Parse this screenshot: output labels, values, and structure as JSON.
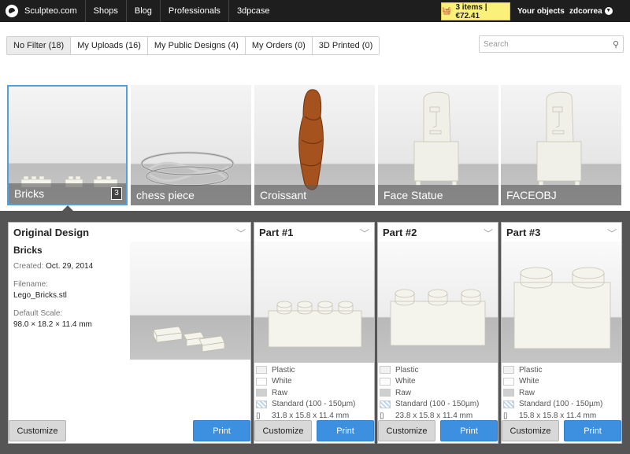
{
  "topbar": {
    "logo_text": "Sculpteo.com",
    "nav": [
      "Shops",
      "Blog",
      "Professionals",
      "3dpcase"
    ],
    "cart_label": "3 items | €72.41",
    "your_objects": "Your objects",
    "user": "zdcorrea"
  },
  "filters": [
    {
      "label": "No Filter",
      "count": "(18)",
      "active": true
    },
    {
      "label": "My Uploads",
      "count": "(16)"
    },
    {
      "label": "My Public Designs",
      "count": "(4)"
    },
    {
      "label": "My Orders",
      "count": "(0)"
    },
    {
      "label": "3D Printed",
      "count": "(0)"
    }
  ],
  "search": {
    "placeholder": "Search"
  },
  "thumbnails": [
    {
      "title": "Bricks",
      "badge": "3",
      "selected": true
    },
    {
      "title": "chess piece"
    },
    {
      "title": "Croissant"
    },
    {
      "title": "Face Statue"
    },
    {
      "title": "FACEOBJ"
    }
  ],
  "original": {
    "header": "Original Design",
    "name": "Bricks",
    "created_label": "Created:",
    "created_value": "Oct. 29, 2014",
    "filename_label": "Filename:",
    "filename_value": "Lego_Bricks.stl",
    "scale_label": "Default Scale:",
    "scale_value": "98.0 × 18.2 × 11.4 mm",
    "customize_label": "Customize",
    "print_label": "Print"
  },
  "parts": [
    {
      "header": "Part #1",
      "material": "Plastic",
      "color": "White",
      "finish": "Raw",
      "quality": "Standard (100 - 150µm)",
      "dimensions": "31.8 x 15.8 x 11.4 mm",
      "customize_label": "Customize",
      "print_label": "Print"
    },
    {
      "header": "Part #2",
      "material": "Plastic",
      "color": "White",
      "finish": "Raw",
      "quality": "Standard (100 - 150µm)",
      "dimensions": "23.8 x 15.8 x 11.4 mm",
      "customize_label": "Customize",
      "print_label": "Print"
    },
    {
      "header": "Part #3",
      "material": "Plastic",
      "color": "White",
      "finish": "Raw",
      "quality": "Standard (100 - 150µm)",
      "dimensions": "15.8 x 15.8 x 11.4 mm",
      "customize_label": "Customize",
      "print_label": "Print"
    }
  ],
  "colors": {
    "accent": "#3d8fe0",
    "cart_bg": "#fbf07a",
    "topbar": "#1e1e1e",
    "panel_bg": "#555555"
  }
}
